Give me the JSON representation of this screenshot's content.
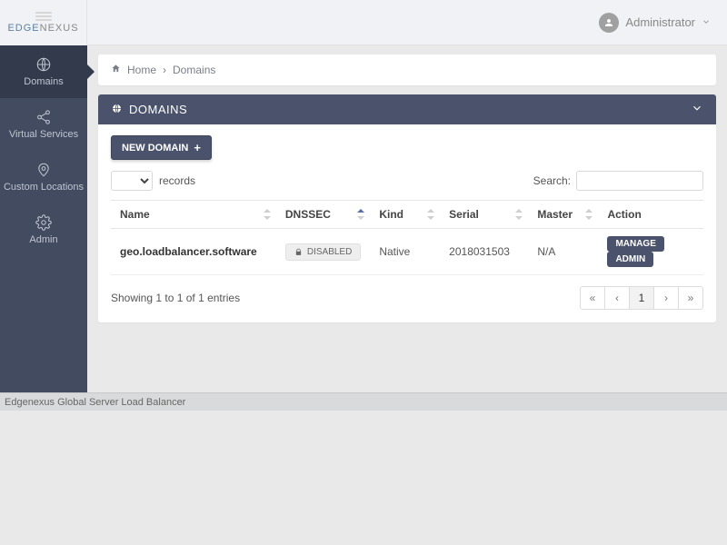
{
  "header": {
    "logo_edge": "EDGE",
    "logo_nexus": "NEXUS",
    "user_name": "Administrator"
  },
  "sidebar": {
    "items": [
      {
        "label": "Domains",
        "icon": "globe",
        "active": true
      },
      {
        "label": "Virtual Services",
        "icon": "share",
        "active": false
      },
      {
        "label": "Custom Locations",
        "icon": "location",
        "active": false
      },
      {
        "label": "Admin",
        "icon": "gear",
        "active": false
      }
    ]
  },
  "breadcrumb": {
    "home": "Home",
    "separator": "›",
    "current": "Domains"
  },
  "panel": {
    "title": "DOMAINS",
    "new_button": "NEW DOMAIN",
    "records_label": "records",
    "search_label": "Search:",
    "search_value": "",
    "columns": {
      "name": "Name",
      "dnssec": "DNSSEC",
      "kind": "Kind",
      "serial": "Serial",
      "master": "Master",
      "action": "Action"
    },
    "rows": [
      {
        "name": "geo.loadbalancer.software",
        "dnssec": "DISABLED",
        "kind": "Native",
        "serial": "2018031503",
        "master": "N/A",
        "manage": "MANAGE",
        "admin": "ADMIN"
      }
    ],
    "info": "Showing 1 to 1 of 1 entries",
    "pagination": {
      "first": "«",
      "prev": "‹",
      "page": "1",
      "next": "›",
      "last": "»"
    }
  },
  "footer": {
    "text": "Edgenexus Global Server Load Balancer"
  }
}
